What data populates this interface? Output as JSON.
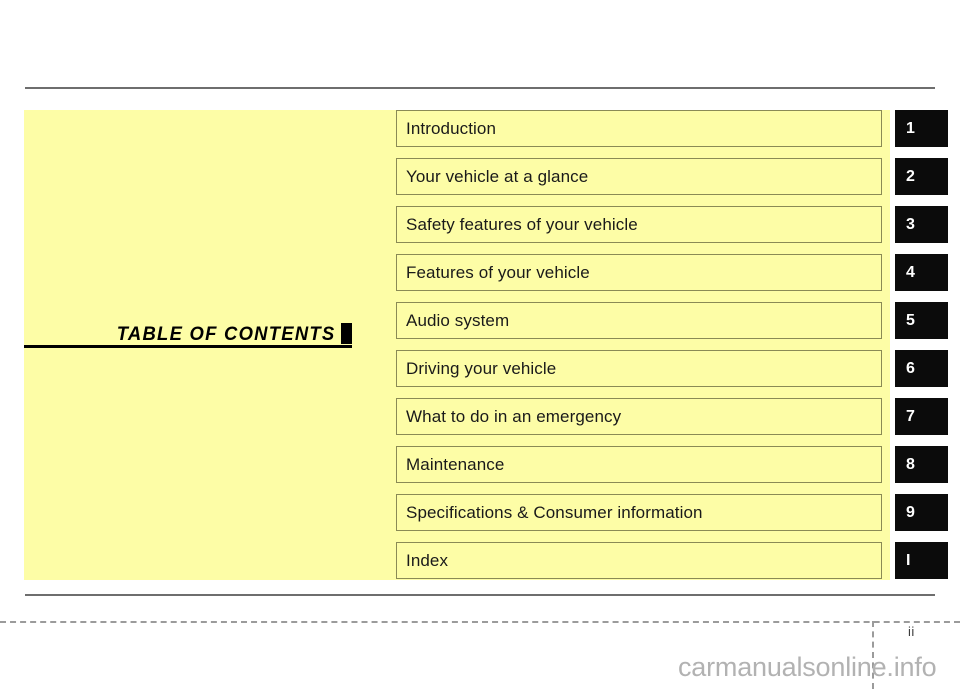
{
  "document": {
    "title": "TABLE OF CONTENTS",
    "page_number": "ii",
    "watermark": "carmanualsonline.info",
    "panel_color": "#FDFDA6",
    "tab_color": "#0B0B0B",
    "border_color": "#8A8A55",
    "rule_color": "#6E6E6E"
  },
  "contents": [
    {
      "label": "Introduction",
      "tab": "1"
    },
    {
      "label": "Your vehicle at a glance",
      "tab": "2"
    },
    {
      "label": "Safety features of your vehicle",
      "tab": "3"
    },
    {
      "label": "Features of your vehicle",
      "tab": "4"
    },
    {
      "label": "Audio system",
      "tab": "5"
    },
    {
      "label": "Driving your vehicle",
      "tab": "6"
    },
    {
      "label": "What to do in an emergency",
      "tab": "7"
    },
    {
      "label": "Maintenance",
      "tab": "8"
    },
    {
      "label": "Specifications & Consumer information",
      "tab": "9"
    },
    {
      "label": "Index",
      "tab": "I"
    }
  ]
}
